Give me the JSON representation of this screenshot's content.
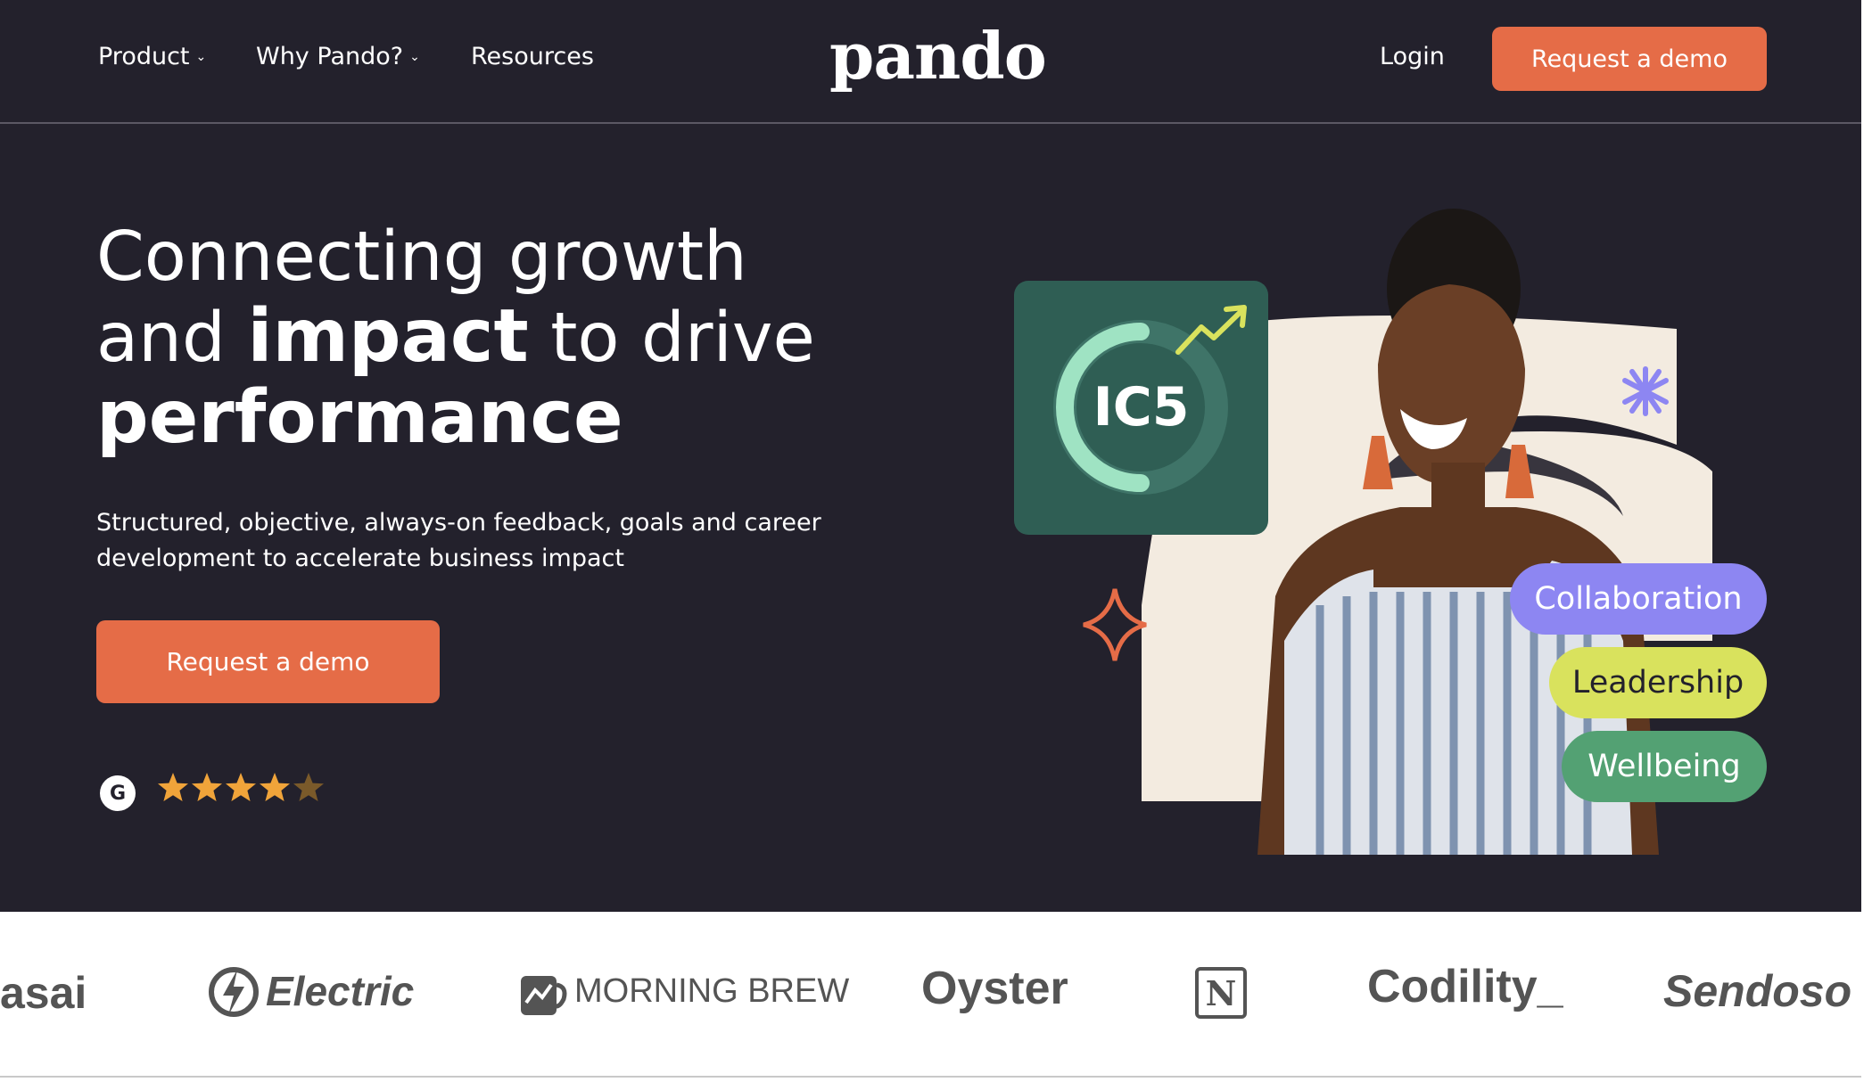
{
  "nav": {
    "product": "Product",
    "why": "Why Pando?",
    "resources": "Resources",
    "logo": "pando",
    "login": "Login",
    "cta": "Request a demo",
    "chevron": "⌄"
  },
  "hero": {
    "headline_line1": "Connecting growth",
    "headline_and": "and ",
    "headline_impact": "impact",
    "headline_drive": " to drive",
    "headline_line3": "performance",
    "subtitle": "Structured, objective, always-on feedback, goals and career development to accelerate business impact",
    "cta": "Request a demo",
    "rating_badge": "G",
    "rating": 4.5,
    "card_label": "IC5",
    "tags": [
      "Collaboration",
      "Leadership",
      "Wellbeing"
    ]
  },
  "customers": [
    "asai",
    "Electric",
    "MORNING BREW",
    "Oyster",
    "N",
    "Codility_",
    "Sendoso"
  ],
  "colors": {
    "nav_bg": "#23212c",
    "accent": "#e56c47",
    "card": "#2f5e54",
    "collab": "#8d86f2",
    "lead": "#d9e25d",
    "well": "#53a173",
    "star": "#f0a43a"
  }
}
